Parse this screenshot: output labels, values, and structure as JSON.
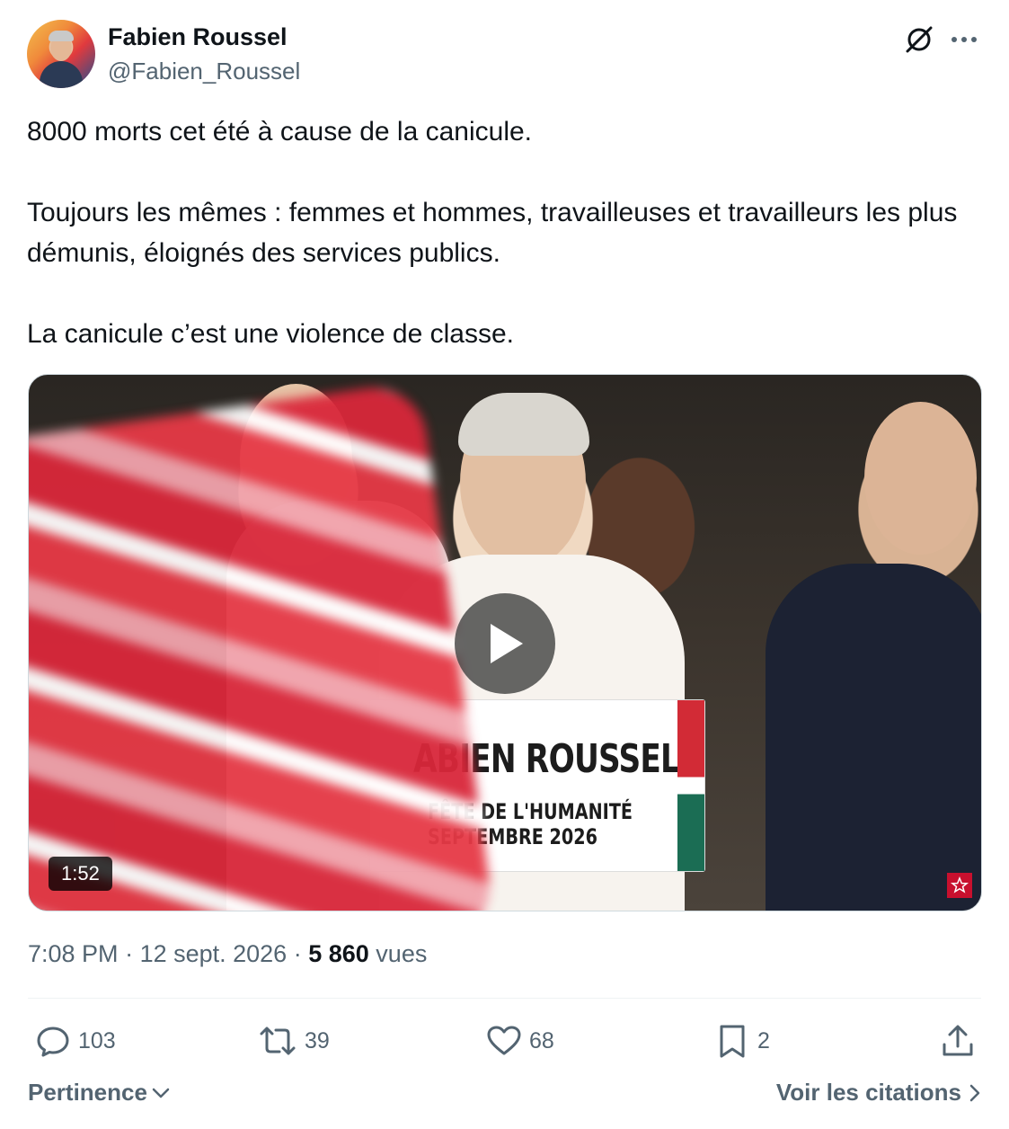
{
  "author": {
    "name": "Fabien Roussel",
    "handle": "@Fabien_Roussel",
    "avatar_icon": "profile-photo"
  },
  "header_icons": {
    "grok": "grok-icon",
    "more": "more-icon"
  },
  "tweet": {
    "paragraphs": [
      "8000 morts cet été à cause de la canicule.",
      "Toujours les mêmes : femmes et hommes, travailleuses et travailleurs les plus démunis, éloignés des services publics.",
      "La canicule c’est une violence de classe."
    ]
  },
  "video": {
    "duration": "1:52",
    "podium_title": "ABIEN ROUSSEL",
    "podium_line1": "FÊTE DE L'HUMANITÉ",
    "podium_line2": "SEPTEMBRE 2026",
    "play_icon": "play-icon"
  },
  "meta": {
    "time": "7:08 PM",
    "separator": " · ",
    "date": "12 sept. 2026",
    "views_count": "5 860",
    "views_label": "vues"
  },
  "actions": {
    "replies": "103",
    "reposts": "39",
    "likes": "68",
    "bookmarks": "2"
  },
  "footer": {
    "sort_label": "Pertinence",
    "quotes_label": "Voir les citations"
  },
  "colors": {
    "text_primary": "#0f1419",
    "text_secondary": "#536471",
    "divider": "#eff3f4"
  }
}
